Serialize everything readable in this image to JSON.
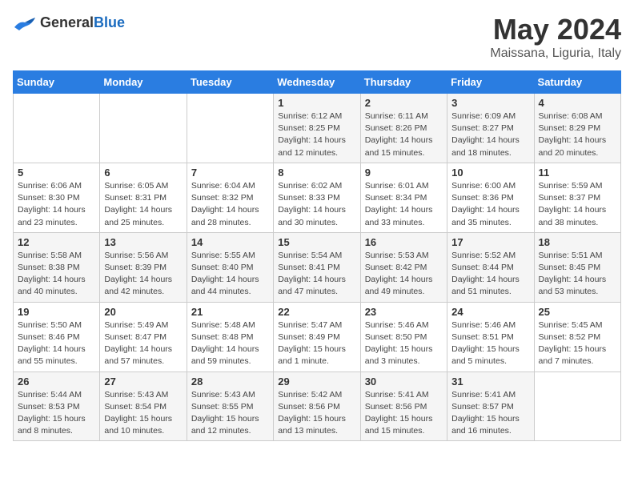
{
  "header": {
    "logo_general": "General",
    "logo_blue": "Blue",
    "month_year": "May 2024",
    "location": "Maissana, Liguria, Italy"
  },
  "calendar": {
    "days_of_week": [
      "Sunday",
      "Monday",
      "Tuesday",
      "Wednesday",
      "Thursday",
      "Friday",
      "Saturday"
    ],
    "weeks": [
      [
        {
          "day": "",
          "info": ""
        },
        {
          "day": "",
          "info": ""
        },
        {
          "day": "",
          "info": ""
        },
        {
          "day": "1",
          "info": "Sunrise: 6:12 AM\nSunset: 8:25 PM\nDaylight: 14 hours\nand 12 minutes."
        },
        {
          "day": "2",
          "info": "Sunrise: 6:11 AM\nSunset: 8:26 PM\nDaylight: 14 hours\nand 15 minutes."
        },
        {
          "day": "3",
          "info": "Sunrise: 6:09 AM\nSunset: 8:27 PM\nDaylight: 14 hours\nand 18 minutes."
        },
        {
          "day": "4",
          "info": "Sunrise: 6:08 AM\nSunset: 8:29 PM\nDaylight: 14 hours\nand 20 minutes."
        }
      ],
      [
        {
          "day": "5",
          "info": "Sunrise: 6:06 AM\nSunset: 8:30 PM\nDaylight: 14 hours\nand 23 minutes."
        },
        {
          "day": "6",
          "info": "Sunrise: 6:05 AM\nSunset: 8:31 PM\nDaylight: 14 hours\nand 25 minutes."
        },
        {
          "day": "7",
          "info": "Sunrise: 6:04 AM\nSunset: 8:32 PM\nDaylight: 14 hours\nand 28 minutes."
        },
        {
          "day": "8",
          "info": "Sunrise: 6:02 AM\nSunset: 8:33 PM\nDaylight: 14 hours\nand 30 minutes."
        },
        {
          "day": "9",
          "info": "Sunrise: 6:01 AM\nSunset: 8:34 PM\nDaylight: 14 hours\nand 33 minutes."
        },
        {
          "day": "10",
          "info": "Sunrise: 6:00 AM\nSunset: 8:36 PM\nDaylight: 14 hours\nand 35 minutes."
        },
        {
          "day": "11",
          "info": "Sunrise: 5:59 AM\nSunset: 8:37 PM\nDaylight: 14 hours\nand 38 minutes."
        }
      ],
      [
        {
          "day": "12",
          "info": "Sunrise: 5:58 AM\nSunset: 8:38 PM\nDaylight: 14 hours\nand 40 minutes."
        },
        {
          "day": "13",
          "info": "Sunrise: 5:56 AM\nSunset: 8:39 PM\nDaylight: 14 hours\nand 42 minutes."
        },
        {
          "day": "14",
          "info": "Sunrise: 5:55 AM\nSunset: 8:40 PM\nDaylight: 14 hours\nand 44 minutes."
        },
        {
          "day": "15",
          "info": "Sunrise: 5:54 AM\nSunset: 8:41 PM\nDaylight: 14 hours\nand 47 minutes."
        },
        {
          "day": "16",
          "info": "Sunrise: 5:53 AM\nSunset: 8:42 PM\nDaylight: 14 hours\nand 49 minutes."
        },
        {
          "day": "17",
          "info": "Sunrise: 5:52 AM\nSunset: 8:44 PM\nDaylight: 14 hours\nand 51 minutes."
        },
        {
          "day": "18",
          "info": "Sunrise: 5:51 AM\nSunset: 8:45 PM\nDaylight: 14 hours\nand 53 minutes."
        }
      ],
      [
        {
          "day": "19",
          "info": "Sunrise: 5:50 AM\nSunset: 8:46 PM\nDaylight: 14 hours\nand 55 minutes."
        },
        {
          "day": "20",
          "info": "Sunrise: 5:49 AM\nSunset: 8:47 PM\nDaylight: 14 hours\nand 57 minutes."
        },
        {
          "day": "21",
          "info": "Sunrise: 5:48 AM\nSunset: 8:48 PM\nDaylight: 14 hours\nand 59 minutes."
        },
        {
          "day": "22",
          "info": "Sunrise: 5:47 AM\nSunset: 8:49 PM\nDaylight: 15 hours\nand 1 minute."
        },
        {
          "day": "23",
          "info": "Sunrise: 5:46 AM\nSunset: 8:50 PM\nDaylight: 15 hours\nand 3 minutes."
        },
        {
          "day": "24",
          "info": "Sunrise: 5:46 AM\nSunset: 8:51 PM\nDaylight: 15 hours\nand 5 minutes."
        },
        {
          "day": "25",
          "info": "Sunrise: 5:45 AM\nSunset: 8:52 PM\nDaylight: 15 hours\nand 7 minutes."
        }
      ],
      [
        {
          "day": "26",
          "info": "Sunrise: 5:44 AM\nSunset: 8:53 PM\nDaylight: 15 hours\nand 8 minutes."
        },
        {
          "day": "27",
          "info": "Sunrise: 5:43 AM\nSunset: 8:54 PM\nDaylight: 15 hours\nand 10 minutes."
        },
        {
          "day": "28",
          "info": "Sunrise: 5:43 AM\nSunset: 8:55 PM\nDaylight: 15 hours\nand 12 minutes."
        },
        {
          "day": "29",
          "info": "Sunrise: 5:42 AM\nSunset: 8:56 PM\nDaylight: 15 hours\nand 13 minutes."
        },
        {
          "day": "30",
          "info": "Sunrise: 5:41 AM\nSunset: 8:56 PM\nDaylight: 15 hours\nand 15 minutes."
        },
        {
          "day": "31",
          "info": "Sunrise: 5:41 AM\nSunset: 8:57 PM\nDaylight: 15 hours\nand 16 minutes."
        },
        {
          "day": "",
          "info": ""
        }
      ]
    ]
  }
}
